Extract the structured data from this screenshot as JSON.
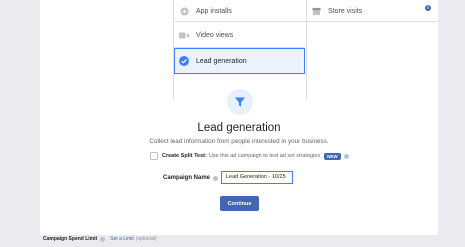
{
  "objectives": {
    "app_installs": "App installs",
    "store_visits": "Store visits",
    "video_views": "Video views",
    "lead_generation": "Lead generation"
  },
  "selected": {
    "title": "Lead generation",
    "description": "Collect lead information from people interested in your business."
  },
  "split_test": {
    "label": "Create Split Test:",
    "text": "Use this ad campaign to test ad set strategies",
    "badge": "NEW"
  },
  "campaign_name": {
    "label": "Campaign Name",
    "value": "Lead Generation - 10/25"
  },
  "continue_label": "Continue",
  "footer": {
    "label": "Campaign Spend Limit",
    "link": "Set a Limit",
    "optional": "(optional)"
  },
  "colors": {
    "accent": "#4267b2",
    "selected_bg": "#ecf3ff"
  }
}
